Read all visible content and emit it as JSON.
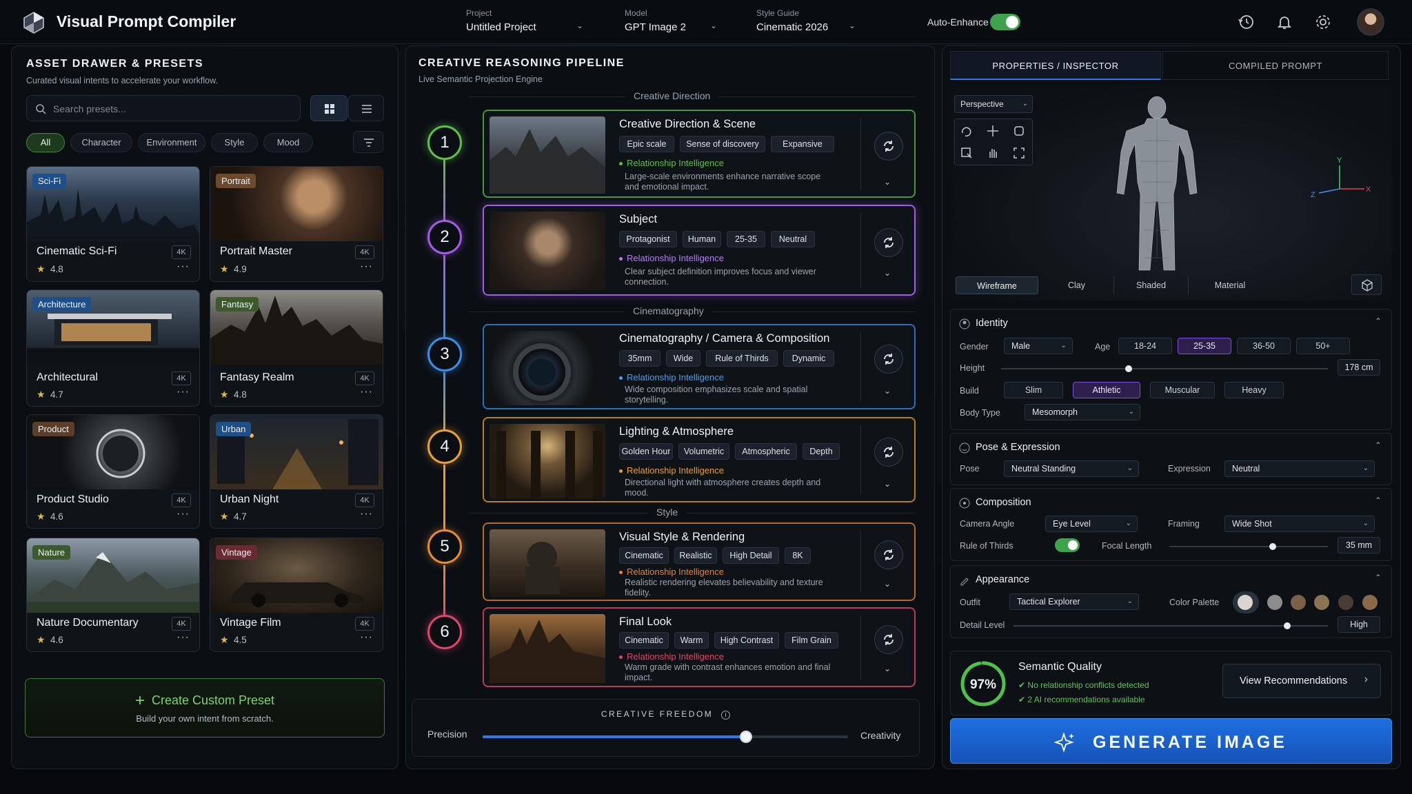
{
  "app": {
    "title": "Visual Prompt Compiler"
  },
  "topbar": {
    "project": {
      "label": "Project",
      "value": "Untitled Project"
    },
    "model": {
      "label": "Model",
      "value": "GPT Image 2"
    },
    "style_guide": {
      "label": "Style Guide",
      "value": "Cinematic 2026"
    },
    "auto_enhance": {
      "label": "Auto-Enhance",
      "on": true
    }
  },
  "asset_drawer": {
    "title": "ASSET DRAWER & PRESETS",
    "subtitle": "Curated visual intents to accelerate your workflow.",
    "search_placeholder": "Search presets...",
    "filters": [
      "All",
      "Character",
      "Environment",
      "Style",
      "Mood"
    ],
    "active_filter": "All",
    "presets": [
      {
        "tag": "Sci-Fi",
        "name": "Cinematic Sci-Fi",
        "res": "4K",
        "rating": "4.8"
      },
      {
        "tag": "Portrait",
        "name": "Portrait Master",
        "res": "4K",
        "rating": "4.9"
      },
      {
        "tag": "Architecture",
        "name": "Architectural",
        "res": "4K",
        "rating": "4.7"
      },
      {
        "tag": "Fantasy",
        "name": "Fantasy Realm",
        "res": "4K",
        "rating": "4.8"
      },
      {
        "tag": "Product",
        "name": "Product Studio",
        "res": "4K",
        "rating": "4.6"
      },
      {
        "tag": "Urban",
        "name": "Urban Night",
        "res": "4K",
        "rating": "4.7"
      },
      {
        "tag": "Nature",
        "name": "Nature Documentary",
        "res": "4K",
        "rating": "4.6"
      },
      {
        "tag": "Vintage",
        "name": "Vintage Film",
        "res": "4K",
        "rating": "4.5"
      }
    ],
    "create": {
      "title": "Create Custom Preset",
      "subtitle": "Build your own intent from scratch."
    }
  },
  "pipeline": {
    "title": "CREATIVE REASONING PIPELINE",
    "subtitle": "Live Semantic Projection Engine",
    "sections": [
      "Creative Direction",
      "Cinematography",
      "Style"
    ],
    "steps": [
      {
        "num": "1",
        "title": "Creative Direction & Scene",
        "tags": [
          "Epic scale",
          "Sense of discovery",
          "Expansive"
        ],
        "ri": "Relationship Intelligence",
        "desc": "Large-scale environments enhance narrative scope and emotional impact.",
        "color": "#5fbf4a"
      },
      {
        "num": "2",
        "title": "Subject",
        "tags": [
          "Protagonist",
          "Human",
          "25-35",
          "Neutral"
        ],
        "ri": "Relationship Intelligence",
        "desc": "Clear subject definition improves focus and viewer connection.",
        "color": "#a45ce6"
      },
      {
        "num": "3",
        "title": "Cinematography / Camera & Composition",
        "tags": [
          "35mm",
          "Wide",
          "Rule of Thirds",
          "Dynamic"
        ],
        "ri": "Relationship Intelligence",
        "desc": "Wide composition emphasizes scale and spatial storytelling.",
        "color": "#3a8ee8"
      },
      {
        "num": "4",
        "title": "Lighting & Atmosphere",
        "tags": [
          "Golden Hour",
          "Volumetric",
          "Atmospheric",
          "Depth"
        ],
        "ri": "Relationship Intelligence",
        "desc": "Directional light with atmosphere creates depth and mood.",
        "color": "#e8a033"
      },
      {
        "num": "5",
        "title": "Visual Style & Rendering",
        "tags": [
          "Cinematic",
          "Realistic",
          "High Detail",
          "8K"
        ],
        "ri": "Relationship Intelligence",
        "desc": "Realistic rendering elevates believability and texture fidelity.",
        "color": "#e88a33"
      },
      {
        "num": "6",
        "title": "Final Look",
        "tags": [
          "Cinematic",
          "Warm",
          "High Contrast",
          "Film Grain"
        ],
        "ri": "Relationship Intelligence",
        "desc": "Warm grade with contrast enhances emotion and final impact.",
        "color": "#e0456b"
      }
    ],
    "freedom": {
      "title": "CREATIVE FREEDOM",
      "left": "Precision",
      "right": "Creativity",
      "value": 0.72
    }
  },
  "inspector": {
    "tabs": [
      "PROPERTIES / INSPECTOR",
      "COMPILED PROMPT"
    ],
    "viewport": {
      "mode": "Perspective",
      "render_modes": [
        "Wireframe",
        "Clay",
        "Shaded",
        "Material"
      ],
      "axes": [
        "Y",
        "Z",
        "X"
      ]
    },
    "identity": {
      "title": "Identity",
      "gender_label": "Gender",
      "gender": "Male",
      "age_label": "Age",
      "ages": [
        "18-24",
        "25-35",
        "36-50",
        "50+"
      ],
      "age_selected": "25-35",
      "height_label": "Height",
      "height": "178 cm",
      "height_level": 0.39,
      "build_label": "Build",
      "builds": [
        "Slim",
        "Athletic",
        "Muscular",
        "Heavy"
      ],
      "build_selected": "Athletic",
      "body_type_label": "Body Type",
      "body_type": "Mesomorph"
    },
    "pose": {
      "title": "Pose & Expression",
      "pose_label": "Pose",
      "pose": "Neutral Standing",
      "expression_label": "Expression",
      "expression": "Neutral"
    },
    "composition": {
      "title": "Composition",
      "camera_angle_label": "Camera Angle",
      "camera_angle": "Eye Level",
      "framing_label": "Framing",
      "framing": "Wide Shot",
      "rule_label": "Rule of Thirds",
      "rule_on": true,
      "focal_label": "Focal Length",
      "focal": "35 mm",
      "focal_level": 0.65
    },
    "appearance": {
      "title": "Appearance",
      "outfit_label": "Outfit",
      "outfit": "Tactical Explorer",
      "palette_label": "Color Palette",
      "palette": [
        "#d9d6d0",
        "#8c8c8c",
        "#7a6248",
        "#8a7452",
        "#4a3e34",
        "#8b6a4c"
      ],
      "detail_label": "Detail Level",
      "detail": "High",
      "detail_level": 0.87
    },
    "quality": {
      "title": "Semantic Quality",
      "score": "97%",
      "score_value": 0.97,
      "check1": "No relationship conflicts detected",
      "check2": "2 AI recommendations available",
      "button": "View Recommendations"
    },
    "generate": "GENERATE IMAGE"
  }
}
